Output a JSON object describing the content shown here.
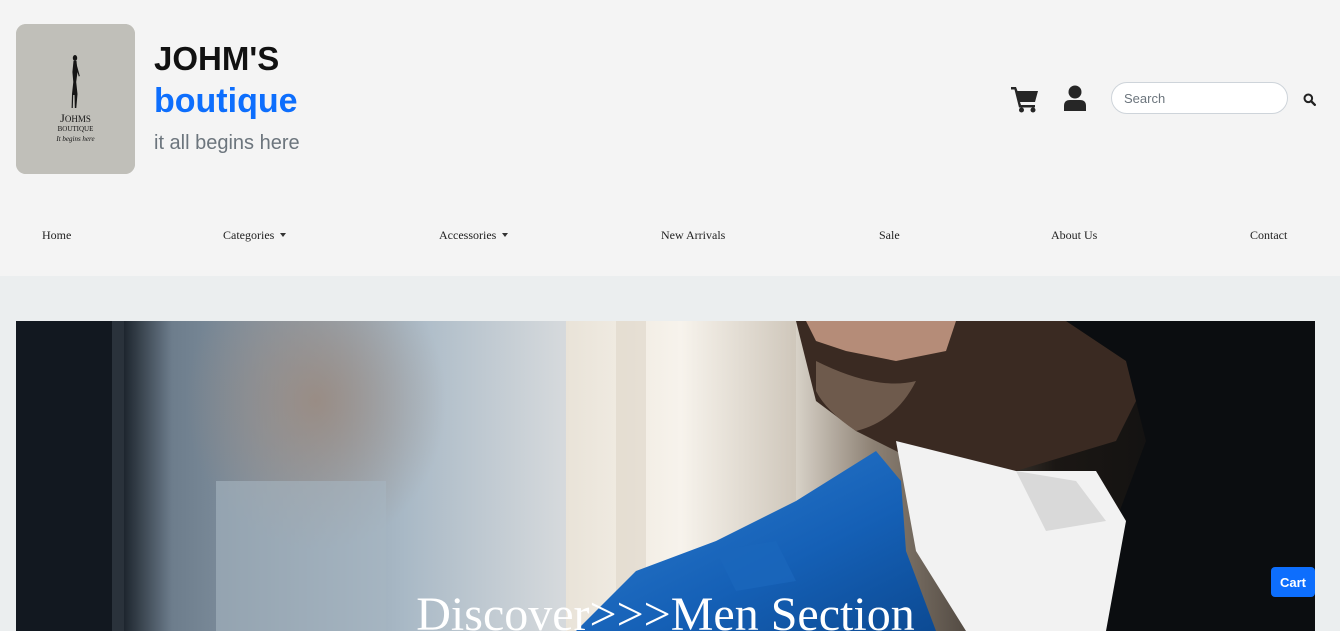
{
  "brand": {
    "name": "JOHM'S",
    "sub": "boutique",
    "tagline": "it all begins here",
    "logo_text": "JOHMS BOUTIQUE It begins here"
  },
  "header_icons": {
    "cart": "shopping-cart-icon",
    "user": "user-icon",
    "search": "search-icon"
  },
  "search": {
    "placeholder": "Search",
    "value": ""
  },
  "nav": {
    "home": "Home",
    "categories": "Categories",
    "accessories": "Accessories",
    "new_arrivals": "New Arrivals",
    "sale": "Sale",
    "about": "About Us",
    "contact": "Contact"
  },
  "hero": {
    "title": "Discover>>>Men Section"
  },
  "cart_button": {
    "label": "Cart"
  },
  "colors": {
    "accent": "#0d6efd",
    "header_bg": "#f4f4f4",
    "page_bg": "#ebeeef",
    "tagline": "#6c757d"
  }
}
